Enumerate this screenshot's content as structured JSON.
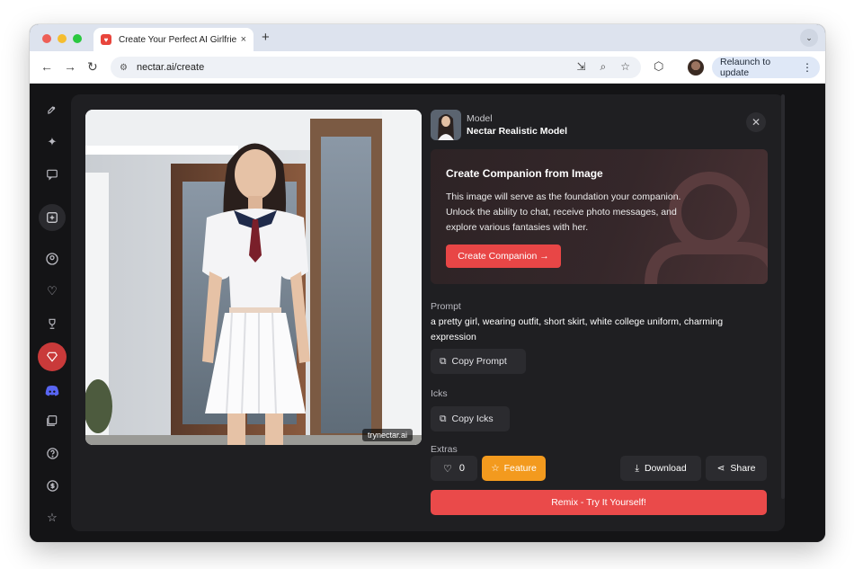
{
  "browser": {
    "tab_title": "Create Your Perfect AI Girlfrie",
    "url": "nectar.ai/create",
    "relaunch_label": "Relaunch to update",
    "new_tab": "+",
    "tab_close": "×",
    "traffic_colors": [
      "#ee5f57",
      "#f5bd2f",
      "#2ac840"
    ]
  },
  "sidebar": {
    "items": [
      {
        "name": "rocket-icon",
        "glyph": "🚀"
      },
      {
        "name": "sparkles-icon",
        "glyph": "✦"
      },
      {
        "name": "chat-icon",
        "glyph": "▭"
      },
      {
        "name": "add-icon",
        "glyph": "+"
      },
      {
        "name": "profile-icon",
        "glyph": "●"
      },
      {
        "name": "heart-icon",
        "glyph": "♡"
      },
      {
        "name": "trophy-icon",
        "glyph": "♜"
      },
      {
        "name": "gem-icon",
        "glyph": "♦"
      },
      {
        "name": "discord-icon",
        "glyph": "◉"
      },
      {
        "name": "gallery-icon",
        "glyph": "▣"
      },
      {
        "name": "help-icon",
        "glyph": "?"
      },
      {
        "name": "coin-icon",
        "glyph": "$"
      },
      {
        "name": "star-icon",
        "glyph": "☆"
      }
    ]
  },
  "image": {
    "watermark": "trynectar.ai"
  },
  "model": {
    "label": "Model",
    "name": "Nectar Realistic Model"
  },
  "companion": {
    "title": "Create Companion from Image",
    "description": "This image will serve as the foundation your companion. Unlock the ability to chat, receive photo messages, and explore various fantasies with her.",
    "button": "Create Companion →"
  },
  "prompt": {
    "label": "Prompt",
    "text": "a pretty girl, wearing outfit, short skirt, white college uniform, charming expression",
    "copy_button": "Copy Prompt"
  },
  "icks": {
    "label": "Icks",
    "copy_button": "Copy Icks"
  },
  "extras": {
    "label": "Extras"
  },
  "actions": {
    "likes": "0",
    "feature": "Feature",
    "download": "Download",
    "share": "Share",
    "remix": "Remix - Try It Yourself!"
  },
  "colors": {
    "accent": "#ea4a4a",
    "feature": "#f39a1e",
    "background": "#1f1f22"
  }
}
